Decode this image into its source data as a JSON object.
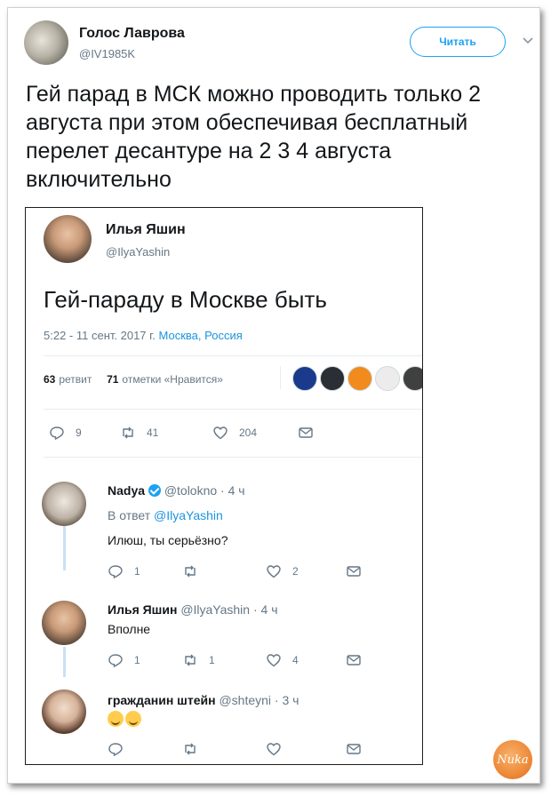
{
  "tweet": {
    "author_name": "Голос Лаврова",
    "author_handle": "@IV1985K",
    "follow_label": "Читать",
    "text": "Гей парад в МСК можно проводить только 2 августа при этом обеспечивая бесплатный перелет десантуре на 2 3 4 августа включительно"
  },
  "quoted": {
    "author_name": "Илья Яшин",
    "author_handle": "@IlyaYashin",
    "text": "Гей-параду в Москве быть",
    "date": "5:22 - 11 сент. 2017 г.",
    "location": "Москва, Россия",
    "retweets_count": "63",
    "retweets_label": "ретвит",
    "likes_count": "71",
    "likes_label": "отметки «Нравится»",
    "reply_count": "9",
    "retweet_action_count": "41",
    "like_action_count": "204",
    "liker_colors": [
      "#1a3a8c",
      "#2a2e35",
      "#f28b1e",
      "#ececec",
      "#404040"
    ]
  },
  "replies": [
    {
      "name": "Nadya",
      "handle": "@tolokno · 4 ч",
      "in_reply_prefix": "В ответ",
      "in_reply_handle": "@IlyaYashin",
      "text": "Илюш, ты серьёзно?",
      "reply_count": "1",
      "retweet_count": "",
      "like_count": "2"
    },
    {
      "name": "Илья Яшин",
      "handle": "@IlyaYashin · 4 ч",
      "text": "Вполне",
      "reply_count": "1",
      "retweet_count": "1",
      "like_count": "4"
    },
    {
      "name": "гражданин штейн",
      "handle": "@shteyni · 3 ч",
      "text": "",
      "reply_count": "",
      "retweet_count": "",
      "like_count": ""
    }
  ],
  "watermark": "Nuka",
  "colors": {
    "accent": "#1da1f2",
    "link": "#1b95e0",
    "muted": "#657786",
    "text": "#14171a"
  }
}
